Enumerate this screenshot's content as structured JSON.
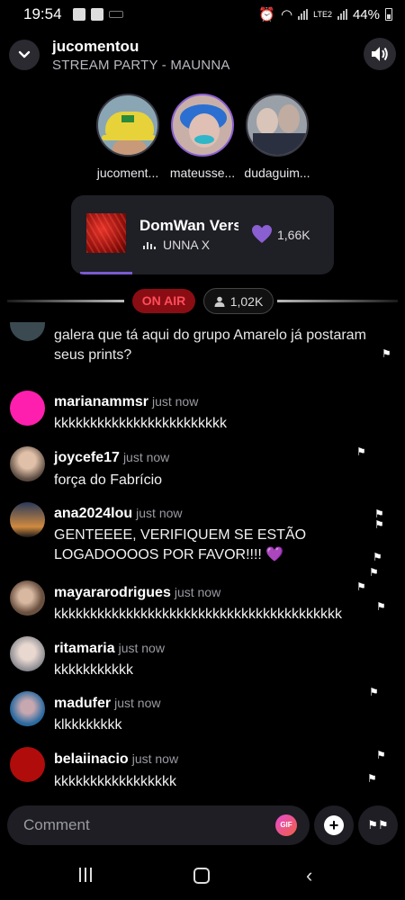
{
  "status_bar": {
    "time": "19:54",
    "battery": "44%",
    "network": "LTE2"
  },
  "header": {
    "title": "jucomentou",
    "subtitle": "STREAM PARTY - MAUNNA"
  },
  "participants": [
    {
      "name": "jucoment..."
    },
    {
      "name": "mateusse..."
    },
    {
      "name": "dudaguim..."
    }
  ],
  "track": {
    "title": "DomWan Versi",
    "artist": "UNNA X",
    "likes": "1,66K",
    "progress": 0.2
  },
  "live": {
    "on_air_label": "ON AIR",
    "viewers": "1,02K"
  },
  "chat": {
    "messages": [
      {
        "user": "",
        "time": "",
        "text": "galera que tá aqui do grupo Amarelo já postaram seus prints?"
      },
      {
        "user": "marianammsr",
        "time": "just now",
        "text": "kkkkkkkkkkkkkkkkkkkkkkkk"
      },
      {
        "user": "joycefe17",
        "time": "just now",
        "text": "força do Fabrício"
      },
      {
        "user": "ana2024lou",
        "time": "just now",
        "text": "GENTEEEE, VERIFIQUEM SE ESTÃO LOGADOOOOS POR FAVOR!!!! 💜"
      },
      {
        "user": "mayararodrigues",
        "time": "just now",
        "text": "kkkkkkkkkkkkkkkkkkkkkkkkkkkkkkkkkkkkkkkk"
      },
      {
        "user": "ritamaria",
        "time": "just now",
        "text": "kkkkkkkkkkk"
      },
      {
        "user": "madufer",
        "time": "just now",
        "text": "klkkkkkkkk"
      },
      {
        "user": "belaiinacio",
        "time": "just now",
        "text": "kkkkkkkkkkkkkkkkk"
      }
    ]
  },
  "composer": {
    "placeholder": "Comment",
    "gif_label": "GIF"
  },
  "colors": {
    "accent": "#8a5fd1",
    "on_air_bg": "#8a0d14",
    "on_air_text": "#ff4d5a",
    "card_bg": "#1f1f26"
  }
}
